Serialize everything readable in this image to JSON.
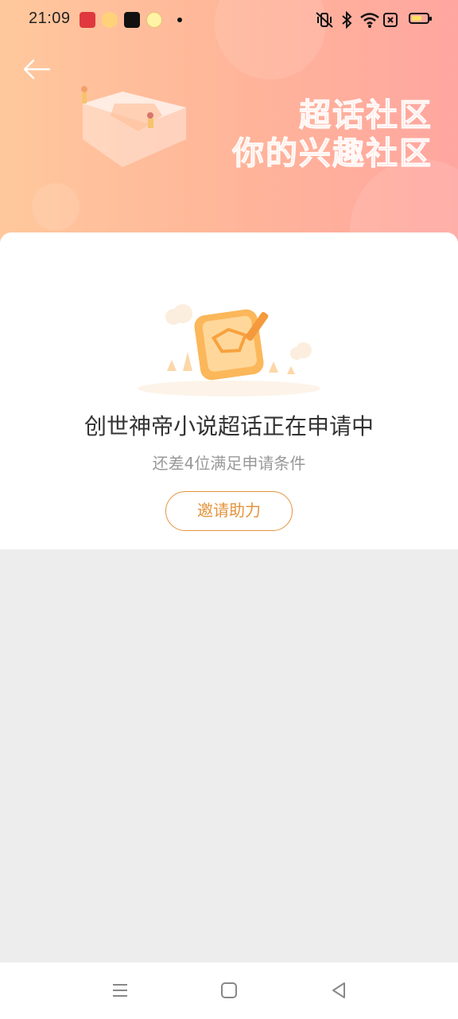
{
  "status_bar": {
    "time": "21:09",
    "notification_icons": [
      "toutiao-icon",
      "weibo-icon",
      "tiktok-icon",
      "mini-app-icon"
    ],
    "system_icons": [
      "vibrate-mute-icon",
      "bluetooth-icon",
      "wifi-icon",
      "sim-off-icon",
      "battery-icon"
    ]
  },
  "header": {
    "back_icon": "arrow-left-icon",
    "title_line1": "超话社区",
    "title_line2": "你的兴趣社区",
    "gradient": [
      "#ffc89c",
      "#ffa6a0"
    ]
  },
  "main": {
    "title": "创世神帝小说超话正在申请中",
    "subtitle": "还差4位满足申请条件",
    "invite_button": "邀请助力",
    "accent": "#e4943d"
  },
  "nav_bar": {
    "icons": [
      "menu-icon",
      "home-square-icon",
      "back-triangle-icon"
    ]
  }
}
